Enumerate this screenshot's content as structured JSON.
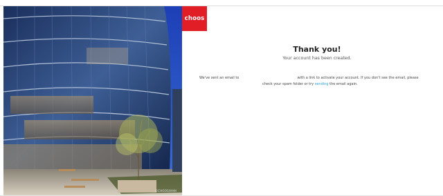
{
  "brand": {
    "logo_text": "choos",
    "logo_color": "#e11d25"
  },
  "photo": {
    "credit": "©CHOOS/HHH",
    "subject": "building-photo"
  },
  "confirmation": {
    "heading": "Thank you!",
    "subtitle": "Your account has been created.",
    "line1_before": "We've sent an email to",
    "line1_after": "with a link to activate your account. If you don't see the email, please",
    "line2_before": "check your spam folder or try",
    "resend_link": "sending",
    "line2_after": "the email again."
  },
  "colors": {
    "link": "#2a9fd8",
    "heading": "#222222"
  }
}
